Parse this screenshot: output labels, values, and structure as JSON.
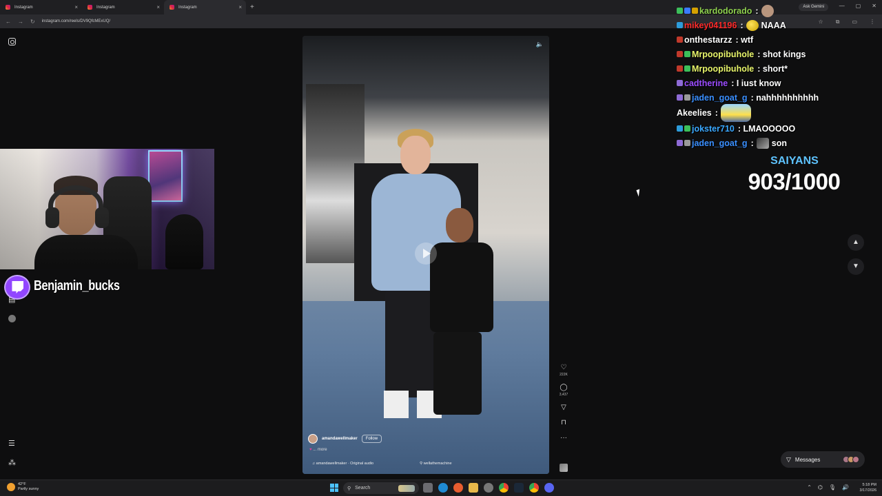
{
  "browser": {
    "tabs": [
      {
        "label": "Instagram",
        "active": false
      },
      {
        "label": "Instagram",
        "active": false
      },
      {
        "label": "Instagram",
        "active": true
      }
    ],
    "new_tab_label": "+",
    "ask_gemini": "Ask Gemini",
    "url": "instagram.com/reels/DV9QfcMExUQ/"
  },
  "reel": {
    "username": "amandawellmaker",
    "follow_label": "Follow",
    "more_label": "... more",
    "audio": "amandawellmaker · Original audio",
    "tagged_user": "wellathemachine",
    "likes": "222K",
    "comments": "3,437"
  },
  "stream": {
    "streamer_name": "Benjamin_bucks",
    "goal_label": "SAIYANS",
    "goal_value": "903/1000"
  },
  "chat": [
    {
      "user": "kardodorado",
      "color": "#8fd14f",
      "message": "",
      "extra": "avatar"
    },
    {
      "user": "mikey041196",
      "color": "#ff2a2a",
      "message": "NAAA",
      "extra": "emote"
    },
    {
      "user": "onthestarzz",
      "color": "#ffffff",
      "message": "wtf",
      "extra": ""
    },
    {
      "user": "Mrpoopibuhole",
      "color": "#e8f56b",
      "message": "shot kings",
      "extra": ""
    },
    {
      "user": "Mrpoopibuhole",
      "color": "#e8f56b",
      "message": "short*",
      "extra": ""
    },
    {
      "user": "cadtherine",
      "color": "#9b4dff",
      "message": "I iust know",
      "extra": ""
    },
    {
      "user": "jaden_goat_g",
      "color": "#3a8fff",
      "message": "nahhhhhhhhhh",
      "extra": ""
    },
    {
      "user": "Akeelies",
      "color": "#ffffff",
      "message": "",
      "extra": "emote-big"
    },
    {
      "user": "jokster710",
      "color": "#3aa8ff",
      "message": "LMAOOOOO",
      "extra": ""
    },
    {
      "user": "jaden_goat_g",
      "color": "#3a8fff",
      "message": "son",
      "extra": "emote"
    }
  ],
  "messages_label": "Messages",
  "taskbar": {
    "weather_temp": "42°F",
    "weather_desc": "Partly sunny",
    "search_label": "Search",
    "time": "5:18 PM",
    "date": "3/17/2026"
  }
}
